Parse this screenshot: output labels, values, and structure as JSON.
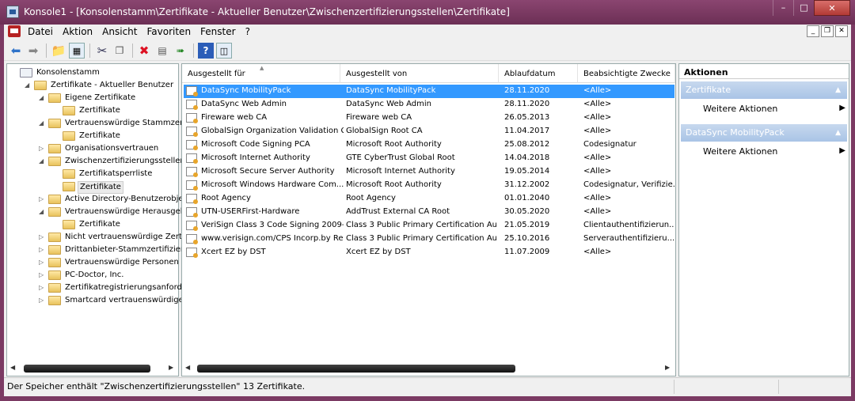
{
  "window": {
    "title": "Konsole1 - [Konsolenstamm\\Zertifikate - Aktueller Benutzer\\Zwischenzertifizierungsstellen\\Zertifikate]"
  },
  "menubar": {
    "items": [
      "Datei",
      "Aktion",
      "Ansicht",
      "Favoriten",
      "Fenster",
      "?"
    ]
  },
  "tree": {
    "items": [
      {
        "label": "Konsolenstamm",
        "level": 0,
        "expander": ""
      },
      {
        "label": "Zertifikate - Aktueller Benutzer",
        "level": 1,
        "expander": "◢"
      },
      {
        "label": "Eigene Zertifikate",
        "level": 2,
        "expander": "◢"
      },
      {
        "label": "Zertifikate",
        "level": 3,
        "expander": ""
      },
      {
        "label": "Vertrauenswürdige Stammzertifi",
        "level": 2,
        "expander": "◢"
      },
      {
        "label": "Zertifikate",
        "level": 3,
        "expander": ""
      },
      {
        "label": "Organisationsvertrauen",
        "level": 2,
        "expander": "▷"
      },
      {
        "label": "Zwischenzertifizierungsstellen",
        "level": 2,
        "expander": "◢"
      },
      {
        "label": "Zertifikatsperrliste",
        "level": 3,
        "expander": ""
      },
      {
        "label": "Zertifikate",
        "level": 3,
        "expander": "",
        "selected": true
      },
      {
        "label": "Active Directory-Benutzerobjekt",
        "level": 2,
        "expander": "▷"
      },
      {
        "label": "Vertrauenswürdige Herausgeber",
        "level": 2,
        "expander": "◢"
      },
      {
        "label": "Zertifikate",
        "level": 3,
        "expander": ""
      },
      {
        "label": "Nicht vertrauenswürdige Zertifik",
        "level": 2,
        "expander": "▷"
      },
      {
        "label": "Drittanbieter-Stammzertifizierur",
        "level": 2,
        "expander": "▷"
      },
      {
        "label": "Vertrauenswürdige Personen",
        "level": 2,
        "expander": "▷"
      },
      {
        "label": "PC-Doctor, Inc.",
        "level": 2,
        "expander": "▷"
      },
      {
        "label": "Zertifikatregistrierungsanforder",
        "level": 2,
        "expander": "▷"
      },
      {
        "label": "Smartcard vertrauenswürdige St",
        "level": 2,
        "expander": "▷"
      }
    ]
  },
  "list": {
    "columns": [
      "Ausgestellt für",
      "Ausgestellt von",
      "Ablaufdatum",
      "Beabsichtigte Zwecke"
    ],
    "sort_indicator": "▲",
    "rows": [
      [
        "DataSync MobilityPack",
        "DataSync MobilityPack",
        "28.11.2020",
        "<Alle>"
      ],
      [
        "DataSync Web Admin",
        "DataSync Web Admin",
        "28.11.2020",
        "<Alle>"
      ],
      [
        "Fireware web CA",
        "Fireware web CA",
        "26.05.2013",
        "<Alle>"
      ],
      [
        "GlobalSign Organization Validation CA",
        "GlobalSign Root CA",
        "11.04.2017",
        "<Alle>"
      ],
      [
        "Microsoft Code Signing PCA",
        "Microsoft Root Authority",
        "25.08.2012",
        "Codesignatur"
      ],
      [
        "Microsoft Internet Authority",
        "GTE CyberTrust Global Root",
        "14.04.2018",
        "<Alle>"
      ],
      [
        "Microsoft Secure Server Authority",
        "Microsoft Internet Authority",
        "19.05.2014",
        "<Alle>"
      ],
      [
        "Microsoft Windows Hardware Com...",
        "Microsoft Root Authority",
        "31.12.2002",
        "Codesignatur, Verifizie..."
      ],
      [
        "Root Agency",
        "Root Agency",
        "01.01.2040",
        "<Alle>"
      ],
      [
        "UTN-USERFirst-Hardware",
        "AddTrust External CA Root",
        "30.05.2020",
        "<Alle>"
      ],
      [
        "VeriSign Class 3 Code Signing 2009-...",
        "Class 3 Public Primary Certification Au...",
        "21.05.2019",
        "Clientauthentifizierun..."
      ],
      [
        "www.verisign.com/CPS Incorp.by Re...",
        "Class 3 Public Primary Certification Au...",
        "25.10.2016",
        "Serverauthentifizieru..."
      ],
      [
        "Xcert EZ by DST",
        "Xcert EZ by DST",
        "11.07.2009",
        "<Alle>"
      ]
    ]
  },
  "actions": {
    "title": "Aktionen",
    "sections": [
      {
        "header": "Zertifikate",
        "item": "Weitere Aktionen"
      },
      {
        "header": "DataSync MobilityPack",
        "item": "Weitere Aktionen"
      }
    ]
  },
  "status": {
    "text": "Der Speicher enthält \"Zwischenzertifizierungsstellen\" 13 Zertifikate."
  },
  "colors": {
    "title_bar": "#7b3a63",
    "selection": "#3399ff",
    "action_header": "#b4cdeb"
  }
}
